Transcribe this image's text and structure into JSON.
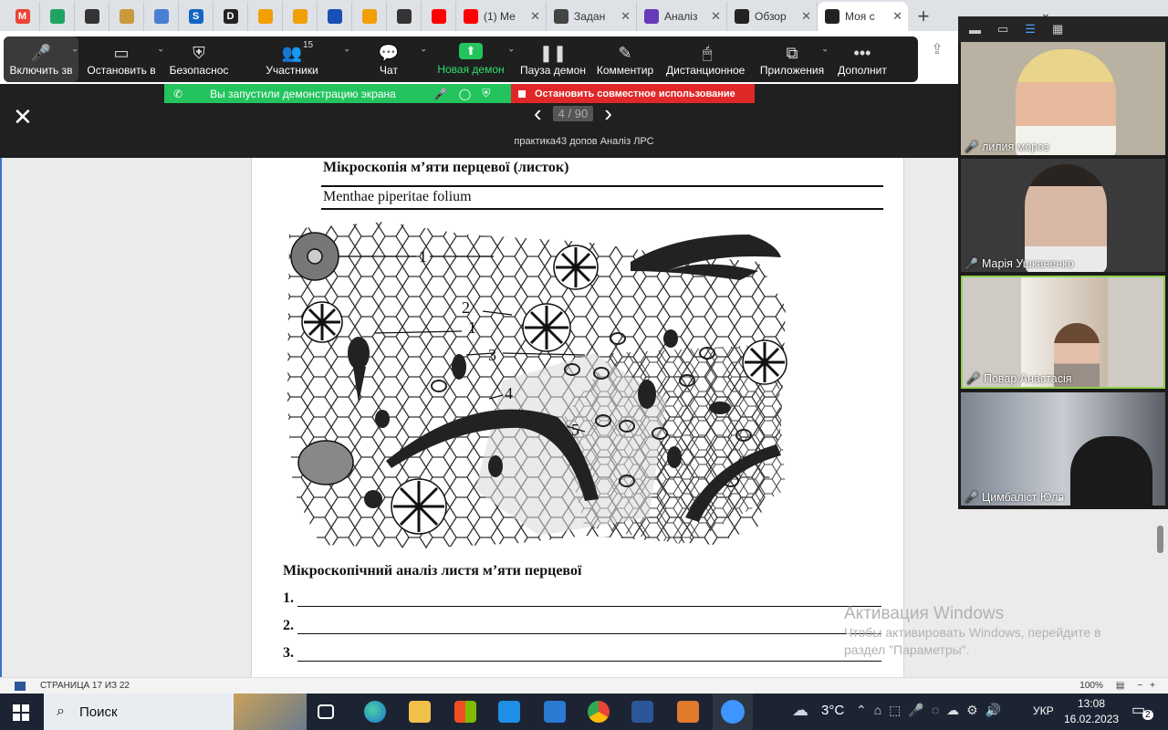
{
  "browser": {
    "tabs": [
      {
        "icon": "gmail-icon",
        "color": "#ea4335",
        "label": "M"
      },
      {
        "icon": "drive-icon",
        "color": "#1fa463",
        "label": ""
      },
      {
        "icon": "globe-icon",
        "color": "#333333",
        "label": ""
      },
      {
        "icon": "broom-icon",
        "color": "#c89a3a",
        "label": ""
      },
      {
        "icon": "pill-icon",
        "color": "#4a7fd4",
        "label": ""
      },
      {
        "icon": "s-icon",
        "color": "#1266c4",
        "label": "S"
      },
      {
        "icon": "d-icon",
        "color": "#222222",
        "label": "D"
      },
      {
        "icon": "alert-icon",
        "color": "#f29f05",
        "label": ""
      },
      {
        "icon": "alert-icon",
        "color": "#f29f05",
        "label": ""
      },
      {
        "icon": "o-icon",
        "color": "#1a4fb5",
        "label": ""
      },
      {
        "icon": "alert-icon",
        "color": "#f29f05",
        "label": ""
      },
      {
        "icon": "globe-icon",
        "color": "#333333",
        "label": ""
      },
      {
        "icon": "youtube-icon",
        "color": "#ff0000",
        "label": ""
      }
    ],
    "wide_tabs": [
      {
        "icon": "youtube-icon",
        "color": "#ff0000",
        "title": "(1) Ме"
      },
      {
        "icon": "classroom-icon",
        "color": "#444444",
        "title": "Задан"
      },
      {
        "icon": "forms-icon",
        "color": "#673ab7",
        "title": "Аналіз"
      },
      {
        "icon": "zoom-app-icon",
        "color": "#222222",
        "title": "Обзор"
      },
      {
        "icon": "zoom-app-icon",
        "color": "#222222",
        "title": "Моя с"
      }
    ],
    "new_tab": "+"
  },
  "zoom_toolbar": {
    "buttons": [
      {
        "name": "unmute",
        "icon": "🎤",
        "label": "Включить зв"
      },
      {
        "name": "start-video",
        "icon": "▭",
        "label": "Остановить в"
      },
      {
        "name": "security",
        "icon": "⛨",
        "label": "Безопаснос"
      },
      {
        "name": "participants",
        "icon": "👥",
        "label": "Участники",
        "count": "15"
      },
      {
        "name": "chat",
        "icon": "💬",
        "label": "Чат"
      },
      {
        "name": "new-share",
        "icon": "⬆",
        "label": "Новая демон"
      },
      {
        "name": "pause-share",
        "icon": "❚❚",
        "label": "Пауза демон"
      },
      {
        "name": "annotate",
        "icon": "✎",
        "label": "Комментир"
      },
      {
        "name": "remote-control",
        "icon": "🖱",
        "label": "Дистанционное у"
      },
      {
        "name": "apps",
        "icon": "⧉",
        "label": "Приложения"
      },
      {
        "name": "more",
        "icon": "•••",
        "label": "Дополнит"
      }
    ],
    "share_banner": "Вы запустили демонстрацию экрана",
    "stop_share": "Остановить совместное использование"
  },
  "viewer": {
    "page_indicator": "4 / 90",
    "doc_title": "практика43 допов Аналіз ЛРС"
  },
  "document": {
    "title": "Мікроскопія м’яти перцевої (листок)",
    "latin": "Menthae piperitae folium",
    "figure_labels": [
      "1",
      "2",
      "1",
      "3",
      "4",
      "5"
    ],
    "subtitle": "Мікроскопічний аналіз листя м’яти перцевої",
    "blanks": [
      "1.",
      "2.",
      "3."
    ]
  },
  "statusbar": {
    "page": "СТРАНИЦА 17 ИЗ 22",
    "zoom": "100%"
  },
  "watermark": {
    "line1": "Активация Windows",
    "line2": "Чтобы активировать Windows, перейдите в",
    "line3": "раздел \"Параметры\"."
  },
  "taskbar": {
    "search": "Поиск",
    "temp": "3°C",
    "lang": "УКР",
    "time": "13:08",
    "date": "16.02.2023",
    "notifications": "2"
  },
  "participants": [
    {
      "name": "лилия мороз",
      "bg": "#b9b2a2"
    },
    {
      "name": "Марія Ушканенко",
      "bg": "#3a3a3a"
    },
    {
      "name": "Повар Анастасія",
      "bg": "#cfcac4"
    },
    {
      "name": "Цимбаліст Юля",
      "bg": "#6a6f7a"
    }
  ]
}
